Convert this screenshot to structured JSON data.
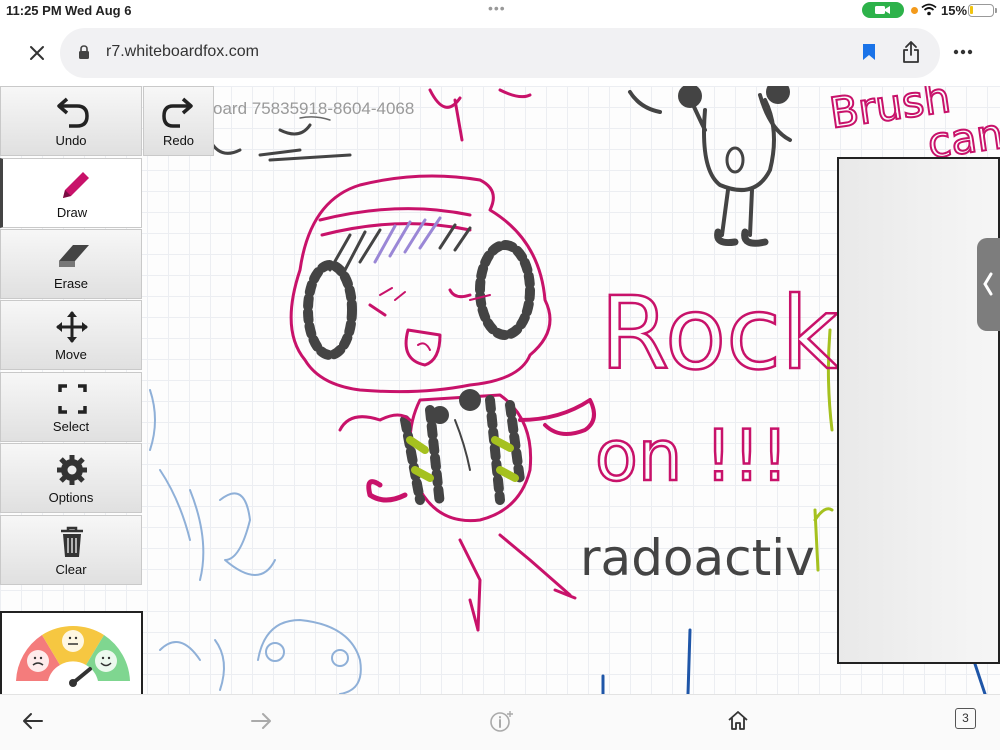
{
  "status_bar": {
    "time": "11:25 PM",
    "date": "Wed Aug 6",
    "battery_percent": "15%",
    "battery_level": 0.15,
    "icons": [
      "camera-icon",
      "wifi-icon",
      "battery-icon"
    ]
  },
  "browser": {
    "url": "r7.whiteboardfox.com",
    "tab_count": "3"
  },
  "board": {
    "id_text": "oard 75835918-8604-4068"
  },
  "toolbar": {
    "undo": "Undo",
    "redo": "Redo",
    "draw": "Draw",
    "erase": "Erase",
    "move": "Move",
    "select": "Select",
    "options": "Options",
    "clear": "Clear",
    "active_tool": "Draw"
  },
  "drawing_text": {
    "rock": "Rock",
    "on": "on !!!",
    "radioactive": "radoactiv",
    "brush": "Brush",
    "can": "can"
  },
  "colors": {
    "magenta": "#c8126a",
    "dark_gray": "#444444",
    "lime": "#a5c11f",
    "light_blue": "#8fb0d8",
    "lavender": "#9a87d6",
    "navy": "#1f56a8"
  }
}
